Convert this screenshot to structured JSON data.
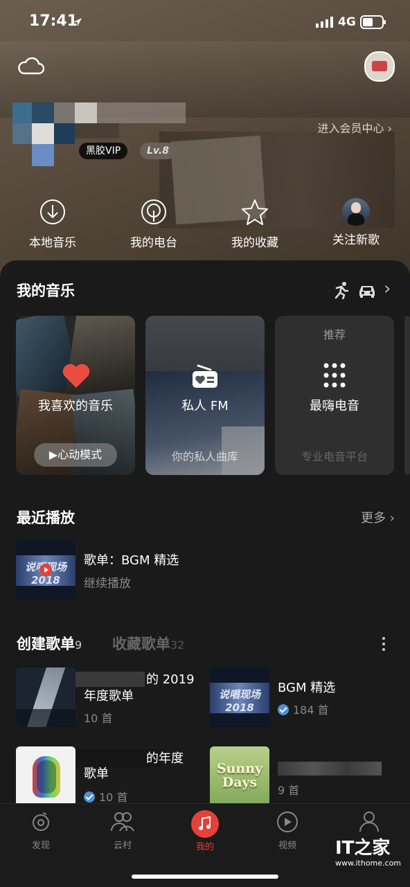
{
  "status_bar": {
    "time": "17:41",
    "network": "4G"
  },
  "profile": {
    "vip_badge": "黑胶VIP",
    "level": "Lv.8",
    "member_center": "进入会员中心"
  },
  "quick_actions": [
    {
      "label": "本地音乐"
    },
    {
      "label": "我的电台"
    },
    {
      "label": "我的收藏"
    },
    {
      "label": "关注新歌"
    }
  ],
  "my_music": {
    "title": "我的音乐",
    "cards": [
      {
        "title": "我喜欢的音乐",
        "sub": "心动模式"
      },
      {
        "title": "私人 FM",
        "sub": "你的私人曲库"
      },
      {
        "tag": "推荐",
        "title": "最嗨电音",
        "sub": "专业电音平台"
      }
    ]
  },
  "recent": {
    "title": "最近播放",
    "more": "更多",
    "item": {
      "name": "歌单：BGM 精选",
      "sub": "继续播放"
    }
  },
  "playlists": {
    "tab_created": "创建歌单",
    "count_created": "9",
    "tab_collected": "收藏歌单",
    "count_collected": "32",
    "items": [
      {
        "name_a": "的 2019",
        "name_b": "年度歌单",
        "count": "10 首"
      },
      {
        "name_a": "BGM 精选",
        "count": "184 首"
      },
      {
        "name_a": "的年度",
        "name_b": "歌单",
        "count": "10 首"
      },
      {
        "count": "9 首"
      }
    ],
    "album_art": {
      "sunny": "Sunny Days",
      "show": "说唱现场 2018"
    }
  },
  "tabs": [
    {
      "label": "发现"
    },
    {
      "label": "云村"
    },
    {
      "label": "我的"
    },
    {
      "label": "视频"
    }
  ],
  "watermark": {
    "brand": "IT之家",
    "url": "www.ithome.com"
  },
  "colors": {
    "accent": "#e5403a",
    "sheet": "#1a1a1a"
  }
}
